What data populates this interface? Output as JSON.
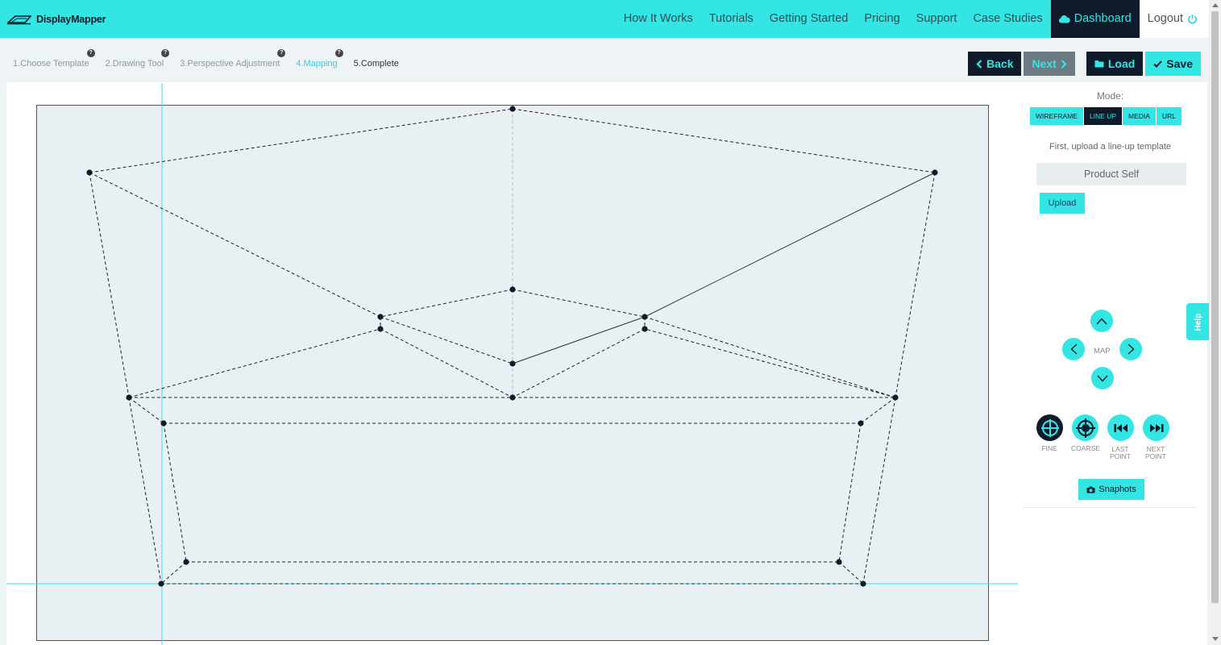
{
  "brand": {
    "name": "DisplayMapper"
  },
  "nav": {
    "items": [
      "How It Works",
      "Tutorials",
      "Getting Started",
      "Pricing",
      "Support",
      "Case Studies"
    ],
    "dashboard": "Dashboard",
    "logout": "Logout"
  },
  "steps": [
    {
      "label": "1.Choose Template",
      "state": "done"
    },
    {
      "label": "2.Drawing Tool",
      "state": "done"
    },
    {
      "label": "3.Perspective Adjustment",
      "state": "done"
    },
    {
      "label": "4.Mapping",
      "state": "active"
    },
    {
      "label": "5.Complete",
      "state": "pending"
    }
  ],
  "actions": {
    "back": "Back",
    "next": "Next",
    "load": "Load",
    "save": "Save"
  },
  "panel": {
    "mode_label": "Mode:",
    "modes": [
      "WIREFRAME",
      "LINE UP",
      "MEDIA",
      "URL"
    ],
    "active_mode": "LINE UP",
    "hint": "First, upload a line-up template",
    "product_value": "Product Self",
    "upload": "Upload",
    "map_label": "MAP",
    "tools": [
      "FINE",
      "COARSE",
      "LAST POINT",
      "NEXT POINT"
    ],
    "snapshots": "Snaphots"
  },
  "help": "Help",
  "colors": {
    "accent": "#33e6e4",
    "dark": "#0f1b2b",
    "canvas": "#e8f0f3"
  }
}
